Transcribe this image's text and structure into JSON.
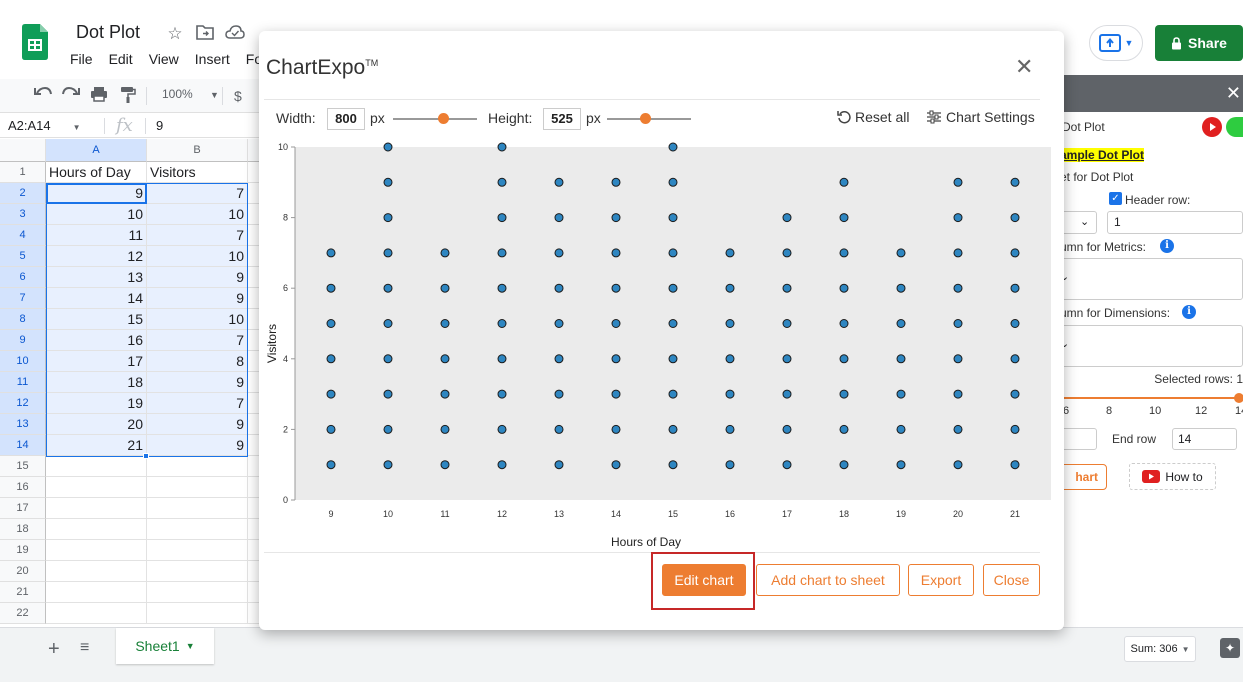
{
  "app": {
    "title": "Dot Plot",
    "menu": [
      "File",
      "Edit",
      "View",
      "Insert",
      "Fo"
    ],
    "share_label": "Share",
    "zoom": "100%",
    "currency": "$",
    "name_box": "A2:A14",
    "fx": "fx",
    "formula_value": "9"
  },
  "grid": {
    "columns": [
      "A",
      "B"
    ],
    "row_numbers": [
      "1",
      "2",
      "3",
      "4",
      "5",
      "6",
      "7",
      "8",
      "9",
      "10",
      "11",
      "12",
      "13",
      "14",
      "15",
      "16",
      "17",
      "18",
      "19",
      "20",
      "21",
      "22"
    ],
    "headers": [
      "Hours of Day",
      "Visitors"
    ],
    "rows": [
      [
        "9",
        "7"
      ],
      [
        "10",
        "10"
      ],
      [
        "11",
        "7"
      ],
      [
        "12",
        "10"
      ],
      [
        "13",
        "9"
      ],
      [
        "14",
        "9"
      ],
      [
        "15",
        "10"
      ],
      [
        "16",
        "7"
      ],
      [
        "17",
        "8"
      ],
      [
        "18",
        "9"
      ],
      [
        "19",
        "7"
      ],
      [
        "20",
        "9"
      ],
      [
        "21",
        "9"
      ]
    ]
  },
  "bottom": {
    "sheet_tab": "Sheet1",
    "sum": "Sum: 306"
  },
  "dialog": {
    "title": "ChartExpo",
    "title_mark": "TM",
    "width_label": "Width:",
    "width_value": "800",
    "height_label": "Height:",
    "height_value": "525",
    "px": "px",
    "reset_label": "Reset all",
    "settings_label": "Chart Settings",
    "buttons": {
      "edit": "Edit chart",
      "add": "Add chart to sheet",
      "export": "Export",
      "close": "Close"
    }
  },
  "side_panel": {
    "title": "Dot Plot",
    "sample_link": "ample Dot Plot",
    "sheet_label": "et for Dot Plot",
    "header_row_label": "Header row:",
    "header_row_value": "1",
    "metrics_label": "umn for Metrics:",
    "dimensions_label": "umn for Dimensions:",
    "selected_rows": "Selected rows: 1",
    "range_ticks": [
      "6",
      "8",
      "10",
      "12",
      "14"
    ],
    "end_row_label": "End row",
    "end_row_value": "14",
    "create_label": "hart",
    "howto_label": "How to"
  },
  "colors": {
    "sheets_green": "#188038",
    "chartexpo_orange": "#ed7d31",
    "dot_fill": "#2e86c1",
    "plot_bg": "#ebebeb",
    "highlight_red": "#c62828"
  },
  "chart_data": {
    "type": "scatter",
    "xlabel": "Hours of Day",
    "ylabel": "Visitors",
    "categories": [
      "9",
      "10",
      "11",
      "12",
      "13",
      "14",
      "15",
      "16",
      "17",
      "18",
      "19",
      "20",
      "21"
    ],
    "values": [
      7,
      10,
      7,
      10,
      9,
      9,
      10,
      7,
      8,
      9,
      7,
      9,
      9
    ],
    "dot_style": "stacked dots from 1 up to value",
    "ylim": [
      0,
      10
    ],
    "yticks": [
      0,
      2,
      4,
      6,
      8,
      10
    ],
    "grid": false
  }
}
